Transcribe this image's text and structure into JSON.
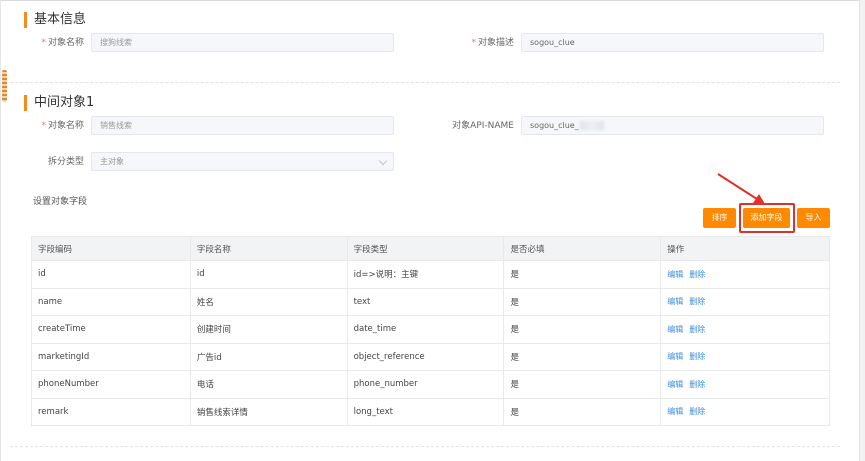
{
  "basic_info": {
    "title": "基本信息",
    "object_name_label": "对象名称",
    "object_name_value": "搜狗线索",
    "object_desc_label": "对象描述",
    "object_desc_value": "sogou_clue"
  },
  "intermediate": {
    "title": "中间对象1",
    "object_name_label": "对象名称",
    "object_name_value": "销售线索",
    "api_name_label": "对象API-NAME",
    "api_name_value": "sogou_clue_",
    "split_type_label": "拆分类型",
    "split_type_value": "主对象"
  },
  "fields_section": {
    "label": "设置对象字段",
    "buttons": {
      "sort": "排序",
      "add_field": "添加字段",
      "import": "导入"
    }
  },
  "table": {
    "headers": [
      "字段编码",
      "字段名称",
      "字段类型",
      "是否必填",
      "操作"
    ],
    "rows": [
      {
        "code": "id",
        "name": "id",
        "type": "id=>说明：主键",
        "required": "是",
        "edit": "编辑",
        "delete": "删除"
      },
      {
        "code": "name",
        "name": "姓名",
        "type": "text",
        "required": "是",
        "edit": "编辑",
        "delete": "删除"
      },
      {
        "code": "createTime",
        "name": "创建时间",
        "type": "date_time",
        "required": "是",
        "edit": "编辑",
        "delete": "删除"
      },
      {
        "code": "marketingId",
        "name": "广告id",
        "type": "object_reference",
        "required": "是",
        "edit": "编辑",
        "delete": "删除"
      },
      {
        "code": "phoneNumber",
        "name": "电话",
        "type": "phone_number",
        "required": "是",
        "edit": "编辑",
        "delete": "删除"
      },
      {
        "code": "remark",
        "name": "销售线索详情",
        "type": "long_text",
        "required": "是",
        "edit": "编辑",
        "delete": "删除"
      }
    ]
  },
  "colors": {
    "accent": "#ff8a00",
    "annotation_red": "#e0312b",
    "link_blue": "#3c8dde"
  }
}
